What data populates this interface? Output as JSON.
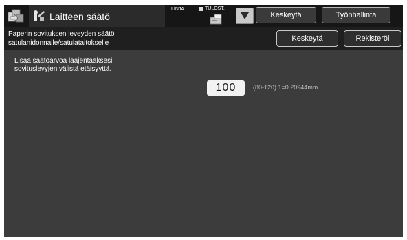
{
  "header": {
    "title": "Laitteen säätö",
    "status_line_label": "LINJA",
    "status_print_label": "TULOST.",
    "interrupt_label": "Keskeytä",
    "job_status_label": "Työnhallinta"
  },
  "subheader": {
    "title_line1": "Paperin sovituksen leveyden säätö",
    "title_line2": "satulanidonnalle/satulataitokselle",
    "cancel_label": "Keskeytä",
    "register_label": "Rekisteröi"
  },
  "content": {
    "instruction_line1": "Lisää säätöarvoa laajentaaksesi",
    "instruction_line2": "sovituslevyjen välistä etäisyyttä.",
    "value": "100",
    "range_hint": "(80-120) 1=0.20944mm"
  },
  "icons": {
    "home": "home-icon",
    "adjust": "adjust-icon",
    "printer": "printer-icon",
    "dropdown": "triangle-down-icon"
  },
  "colors": {
    "background": "#3c3c3c",
    "topbar": "#161616",
    "button_border": "#b8b8b8",
    "value_box": "#f2f2f2"
  }
}
